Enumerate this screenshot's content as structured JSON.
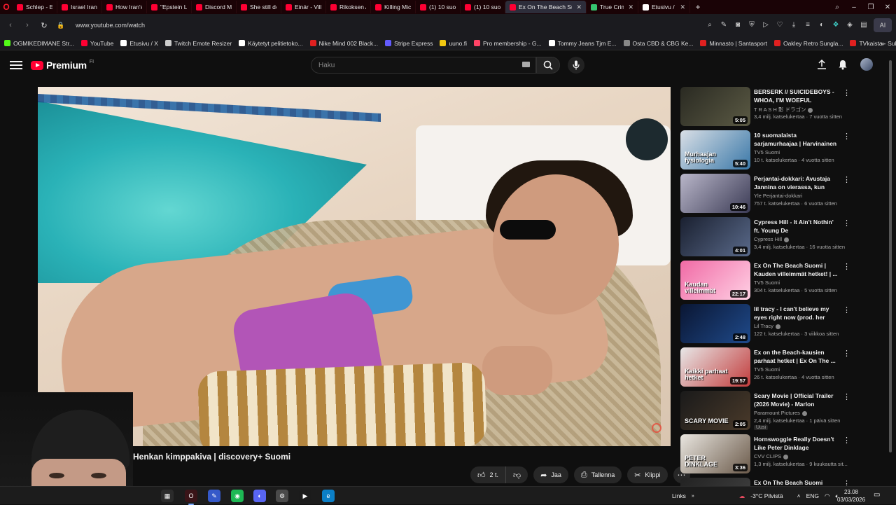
{
  "browser": {
    "tabs": [
      {
        "label": "Schlep - EVERY",
        "color": "#ff0033"
      },
      {
        "label": "Israel Iran War I",
        "color": "#ff0033"
      },
      {
        "label": "How Iran's Lea",
        "color": "#ff0033"
      },
      {
        "label": "\"Epstein LIES\"",
        "color": "#ff0033"
      },
      {
        "label": "Discord Moder",
        "color": "#ff0033"
      },
      {
        "label": "She still doesn't",
        "color": "#ff0033"
      },
      {
        "label": "Einár - Vill va m",
        "color": "#ff0033"
      },
      {
        "label": "Rikoksen Anat",
        "color": "#ff0033"
      },
      {
        "label": "Killing Michael",
        "color": "#ff0033"
      },
      {
        "label": "(1) 10 suomala",
        "color": "#ff0033"
      },
      {
        "label": "(1) 10 suomala",
        "color": "#ff0033"
      },
      {
        "label": "Ex On The Beach Suo",
        "color": "#ff0033",
        "active": true
      },
      {
        "label": "True Crime",
        "color": "#36c46f"
      },
      {
        "label": "Etusivu / X",
        "color": "#ffffff"
      }
    ],
    "url": "www.youtube.com/watch",
    "bookmarks": [
      {
        "label": "OGMIKEDIMANE Str...",
        "color": "#53fc18"
      },
      {
        "label": "YouTube",
        "color": "#ff0033"
      },
      {
        "label": "Etusivu / X",
        "color": "#ffffff"
      },
      {
        "label": "Twitch Emote Resizer",
        "color": "#cccccc"
      },
      {
        "label": "Käytetyt pelitietoko...",
        "color": "#ffffff"
      },
      {
        "label": "Nike Mind 002 Black...",
        "color": "#e02020"
      },
      {
        "label": "Stripe Express",
        "color": "#635bff"
      },
      {
        "label": "uuno.fi",
        "color": "#f2c811"
      },
      {
        "label": "Pro membership - G...",
        "color": "#ff4466"
      },
      {
        "label": "Tommy Jeans Tjm E...",
        "color": "#ffffff"
      },
      {
        "label": "Osta CBD & CBG Ke...",
        "color": "#888888"
      },
      {
        "label": "Minnasto | Santasport",
        "color": "#e02020"
      },
      {
        "label": "Oakley Retro Sungla...",
        "color": "#e02020"
      },
      {
        "label": "TVkaista - Sub Suora",
        "color": "#e02020"
      }
    ],
    "ai_label": "AI"
  },
  "youtube": {
    "logo_text": "Premium",
    "logo_country": "FI",
    "search_placeholder": "Haku",
    "accent": "#ff0033"
  },
  "video": {
    "title": "Henkan kimppakiva | discovery+ Suomi",
    "like_count": "2 t.",
    "share_label": "Jaa",
    "save_label": "Tallenna",
    "clip_label": "Klippi"
  },
  "recommendations": [
    {
      "title": "BERSERK // SUICIDEBOYS - WHOA, I'M WOEFUL",
      "channel": "T R A S H 影 ドラゴン",
      "verified": true,
      "meta": "3,4 milj. katselukertaa · 7 vuotta sitten",
      "duration": "5:05",
      "thumb": [
        "#2a2a22",
        "#5b5a44"
      ]
    },
    {
      "title": "10 suomalaista sarjamurhaajaa | Harvinainen salaisuus teki ...",
      "channel": "TV5 Suomi",
      "verified": false,
      "meta": "10 t. katselukertaa · 4 vuotta sitten",
      "duration": "5:40",
      "thumb": [
        "#d9dfe6",
        "#3a78a8"
      ],
      "thumb_text": "Murhaajan fysiologia"
    },
    {
      "title": "Perjantai-dokkari: Avustaja Jannina on vierassa, kun Miik...",
      "channel": "Yle Perjantai-dokkari",
      "verified": false,
      "meta": "757 t. katselukertaa · 6 vuotta sitten",
      "duration": "10:46",
      "thumb": [
        "#b9b6c9",
        "#3b3b55"
      ]
    },
    {
      "title": "Cypress Hill - It Ain't Nothin' ft. Young De",
      "channel": "Cypress Hill",
      "verified": true,
      "meta": "3,4 milj. katselukertaa · 16 vuotta sitten",
      "duration": "4:01",
      "thumb": [
        "#1a2030",
        "#5a6a8a"
      ]
    },
    {
      "title": "Ex On The Beach Suomi | Kauden villeimmät hetket! | ...",
      "channel": "TV5 Suomi",
      "verified": false,
      "meta": "304 t. katselukertaa · 5 vuotta sitten",
      "duration": "22:17",
      "thumb": [
        "#f06aa5",
        "#ffd0e4"
      ],
      "thumb_text": "Kaudan villeimmät"
    },
    {
      "title": "lil tracy - I can't believe my eyes right now (prod. her blood 🔴)",
      "channel": "Lil Tracy",
      "verified": true,
      "meta": "122 t. katselukertaa · 3 viikkoa sitten",
      "duration": "2:48",
      "thumb": [
        "#0a1633",
        "#1f4a8a"
      ]
    },
    {
      "title": "Ex on the Beach-kausien parhaat hetket | Ex On The ...",
      "channel": "TV5 Suomi",
      "verified": false,
      "meta": "26 t. katselukertaa · 4 vuotta sitten",
      "duration": "19:57",
      "thumb": [
        "#e8e8e8",
        "#c23b3b"
      ],
      "thumb_text": "Kaikki parhaat hetket"
    },
    {
      "title": "Scary Movie | Official Trailer (2026 Movie) - Marlon Wayan...",
      "channel": "Paramount Pictures",
      "verified": true,
      "meta": "2,4 milj. katselukertaa · 1 päivä sitten",
      "duration": "2:05",
      "badge": "Uusi",
      "thumb": [
        "#1a1a1a",
        "#4a3a2a"
      ],
      "thumb_text": "SCARY MOVIE"
    },
    {
      "title": "Hornswoggle Really Doesn't Like Peter Dinklage",
      "channel": "CVV CLIPS",
      "verified": true,
      "meta": "1,3 milj. katselukertaa · 9 kuukautta sit...",
      "duration": "3:36",
      "thumb": [
        "#e9e6e0",
        "#6b5a4a"
      ],
      "thumb_text": "PETER DINKLAGE"
    },
    {
      "title": "Ex On The Beach Suomi",
      "channel": "",
      "verified": false,
      "meta": "",
      "duration": "",
      "thumb": [
        "#222",
        "#444"
      ]
    }
  ],
  "taskbar": {
    "apps": [
      {
        "name": "task-view",
        "color": "#2b2b2b",
        "glyph": "▦"
      },
      {
        "name": "opera-gx",
        "color": "#3a1418",
        "glyph": "O",
        "active": true
      },
      {
        "name": "notes",
        "color": "#3559c9",
        "glyph": "✎"
      },
      {
        "name": "spotify",
        "color": "#1db954",
        "glyph": "◉"
      },
      {
        "name": "discord",
        "color": "#5865f2",
        "glyph": "◐"
      },
      {
        "name": "steam",
        "color": "#4a4a4a",
        "glyph": "⚙"
      },
      {
        "name": "kick",
        "color": "#1b1b1b",
        "glyph": "▶"
      },
      {
        "name": "edge",
        "color": "#0b7fc7",
        "glyph": "e"
      }
    ],
    "links_label": "Links",
    "weather": "-3°C  Pilvistä",
    "language": "ENG",
    "time": "23.08",
    "date": "03/03/2026"
  }
}
